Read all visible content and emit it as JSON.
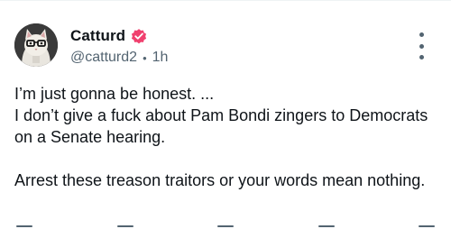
{
  "post": {
    "author": {
      "display_name": "Catturd",
      "handle": "@catturd2",
      "verified": true,
      "avatar_icon": "cat-with-glasses-avatar"
    },
    "separator": "•",
    "time": "1h",
    "body": {
      "paragraph1_line1": "I’m just gonna be honest. ...",
      "paragraph1_line2": "I don’t give a fuck about Pam Bondi zingers to Democrats on a Senate hearing.",
      "paragraph2": "Arrest these treason traitors or your words mean nothing."
    },
    "more_icon": "vertical-ellipsis-icon",
    "actions": [
      "reply-icon",
      "repost-icon",
      "like-icon",
      "views-icon",
      "share-icon"
    ]
  },
  "colors": {
    "text": "#0f1419",
    "secondary": "#536471",
    "verified_badge": "#f0406e",
    "divider": "#eff3f4"
  }
}
